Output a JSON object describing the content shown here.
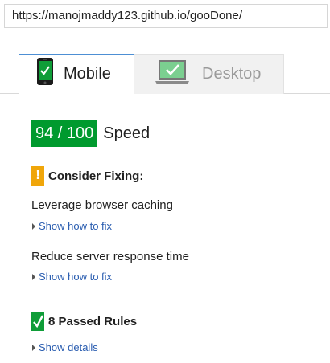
{
  "url": "https://manojmaddy123.github.io/gooDone/",
  "tabs": [
    {
      "label": "Mobile",
      "icon": "phone-check-icon",
      "active": true
    },
    {
      "label": "Desktop",
      "icon": "monitor-check-icon",
      "active": false
    }
  ],
  "score": {
    "value": "94 / 100",
    "label": "Speed",
    "color": "#009a2e"
  },
  "consider_fixing": {
    "badge": "!",
    "heading": "Consider Fixing:",
    "color": "#f0a60a",
    "rules": [
      {
        "title": "Leverage browser caching",
        "toggle": "Show how to fix"
      },
      {
        "title": "Reduce server response time",
        "toggle": "Show how to fix"
      }
    ]
  },
  "passed": {
    "heading": "8 Passed Rules",
    "toggle": "Show details",
    "color": "#0f9d38"
  },
  "colors": {
    "link": "#2a5db0",
    "tab_border": "#4d8fd4"
  }
}
